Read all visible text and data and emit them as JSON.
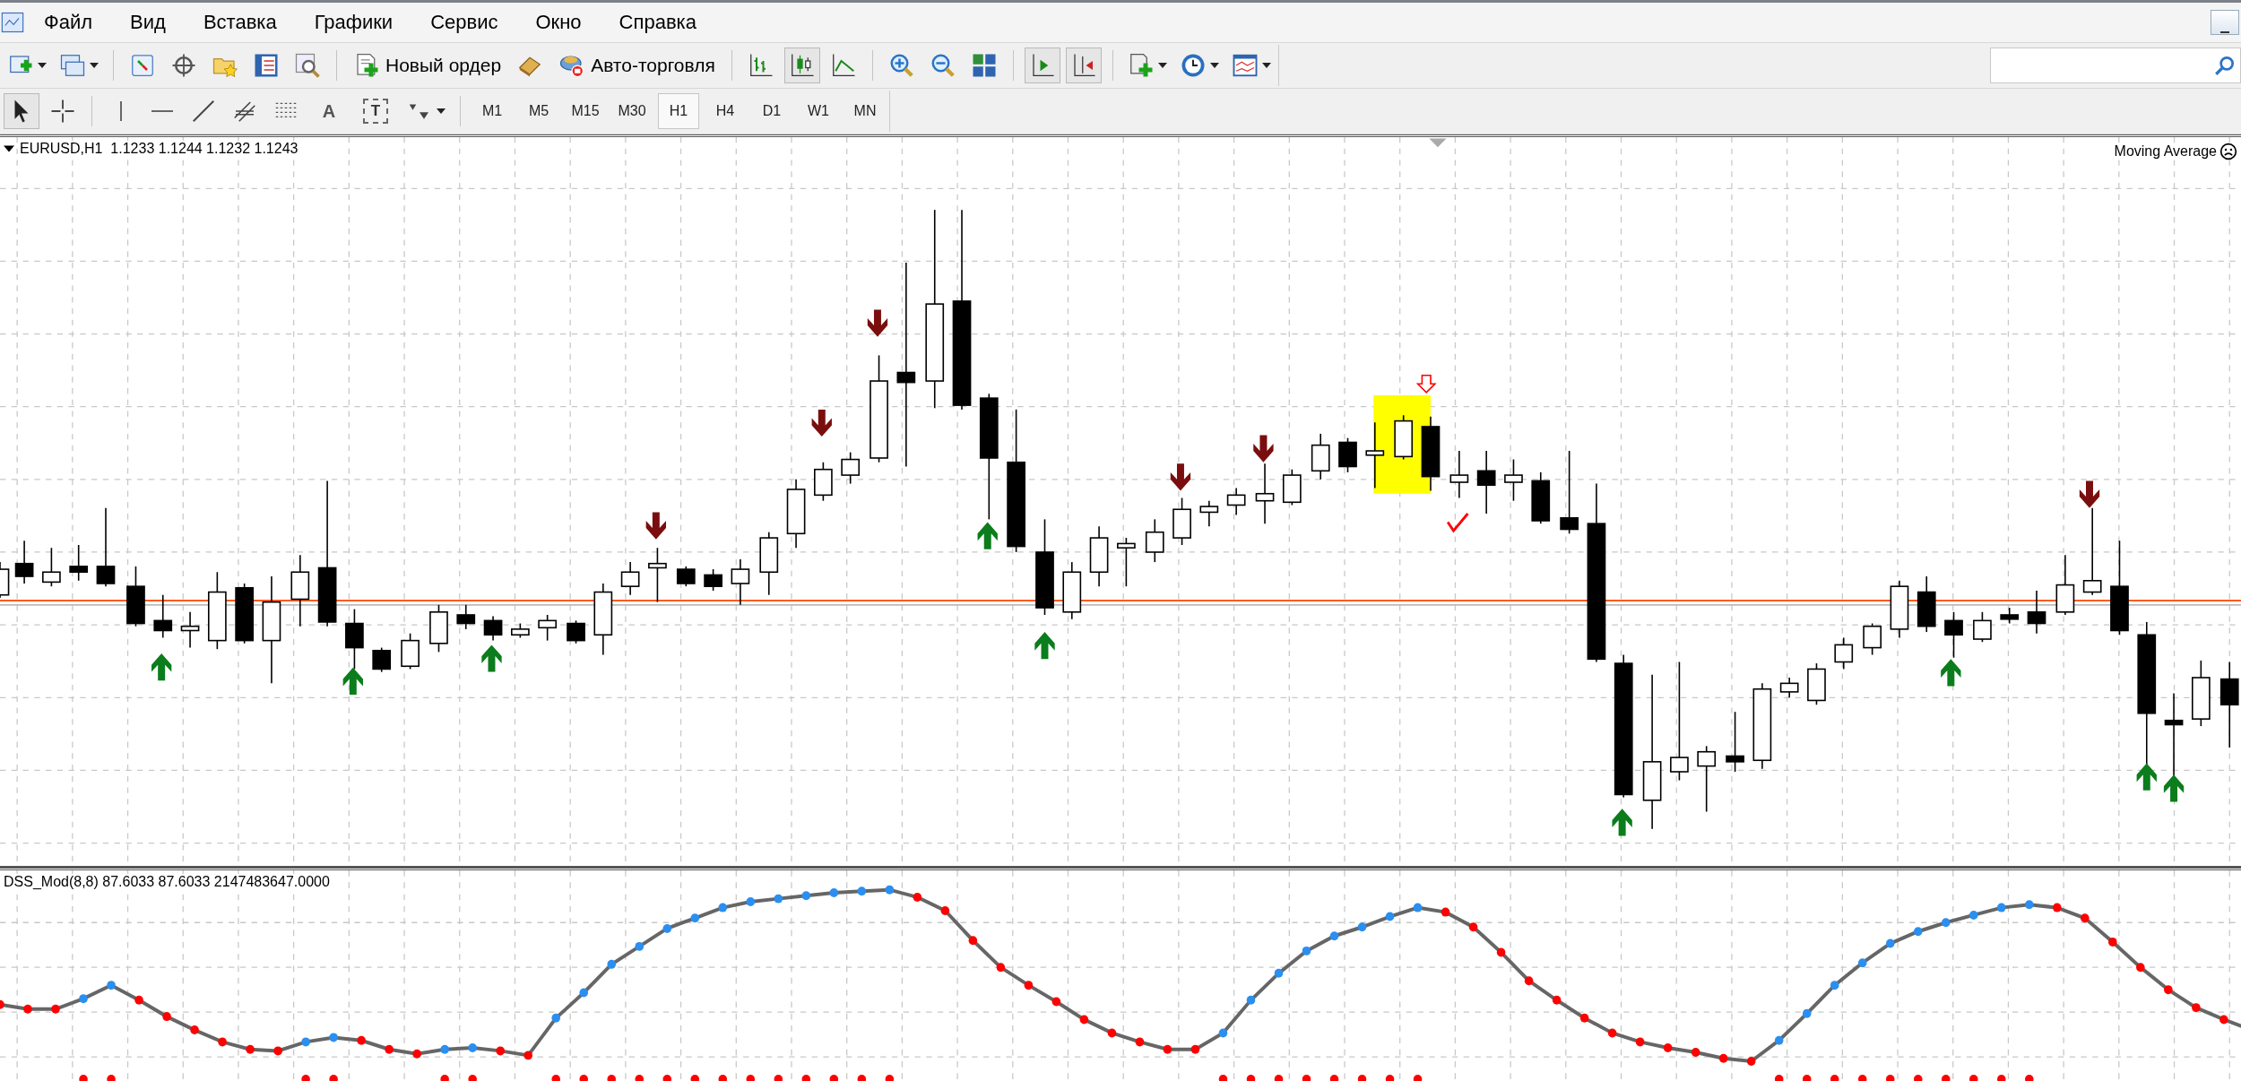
{
  "menu": [
    "Файл",
    "Вид",
    "Вставка",
    "Графики",
    "Сервис",
    "Окно",
    "Справка"
  ],
  "toolbar": {
    "new_order": "Новый ордер",
    "auto_trading": "Авто-торговля"
  },
  "drawing_tools": {
    "text_tool": "A",
    "label_tool": "T"
  },
  "timeframes": [
    {
      "label": "M1",
      "selected": false
    },
    {
      "label": "M5",
      "selected": false
    },
    {
      "label": "M15",
      "selected": false
    },
    {
      "label": "M30",
      "selected": false
    },
    {
      "label": "H1",
      "selected": true
    },
    {
      "label": "H4",
      "selected": false
    },
    {
      "label": "D1",
      "selected": false
    },
    {
      "label": "W1",
      "selected": false
    },
    {
      "label": "MN",
      "selected": false
    }
  ],
  "chart": {
    "symbol_info": "EURUSD,H1  1.1233 1.1244 1.1232 1.1243",
    "indicator_label": "Moving Average"
  },
  "subwindow": {
    "label": "DSS_Mod(8,8) 87.6033 87.6033 2147483647.0000"
  }
}
